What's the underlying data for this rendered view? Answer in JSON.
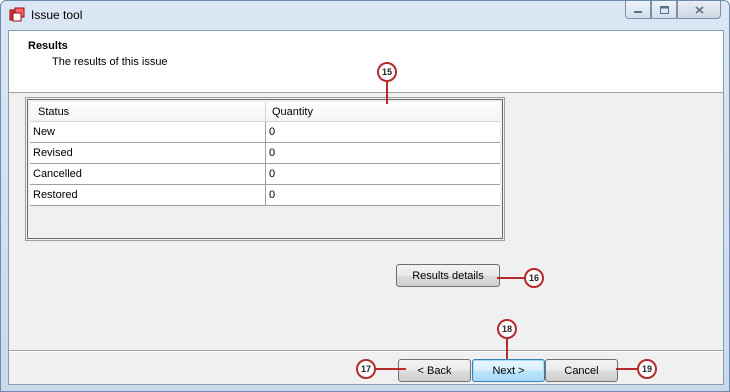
{
  "window": {
    "title": "Issue tool"
  },
  "header": {
    "title": "Results",
    "subtitle": "The results of this issue"
  },
  "grid": {
    "columns": [
      "Status",
      "Quantity"
    ],
    "rows": [
      [
        "New",
        "0"
      ],
      [
        "Revised",
        "0"
      ],
      [
        "Cancelled",
        "0"
      ],
      [
        "Restored",
        "0"
      ]
    ]
  },
  "buttons": {
    "results_details": "Results details",
    "back": "< Back",
    "next": "Next >",
    "cancel": "Cancel"
  },
  "callouts": {
    "c15": "15",
    "c16": "16",
    "c17": "17",
    "c18": "18",
    "c19": "19"
  },
  "colors": {
    "callout": "#b52a2a",
    "title_bar": "#dbe7f4",
    "client_bg": "#f0f0f0"
  },
  "icons": {
    "app": "red-square-app-icon",
    "minimize": "minimize-icon",
    "maximize": "maximize-icon",
    "close": "close-icon"
  }
}
